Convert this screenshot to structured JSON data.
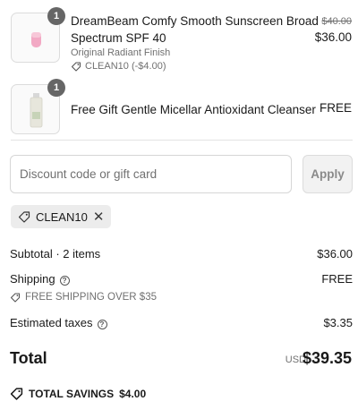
{
  "items": [
    {
      "quantity": "1",
      "title_line1": "DreamBeam Comfy Smooth Sunscreen Broad",
      "title_line2": "Spectrum SPF 40",
      "variant": "Original Radiant Finish",
      "discount_note": "CLEAN10 (-$4.00)",
      "price_original": "$40.00",
      "price": "$36.00",
      "thumb_icon": "sunscreen-bottle-icon"
    },
    {
      "quantity": "1",
      "title_line1": "Free Gift Gentle Micellar Antioxidant Cleanser",
      "price": "FREE",
      "thumb_icon": "cleanser-bottle-icon"
    }
  ],
  "discount": {
    "placeholder": "Discount code or gift card",
    "value": "",
    "apply_label": "Apply",
    "applied_code": "CLEAN10"
  },
  "summary": {
    "subtotal_label": "Subtotal · 2 items",
    "subtotal_value": "$36.00",
    "shipping_label": "Shipping",
    "shipping_value": "FREE",
    "shipping_note": "FREE SHIPPING OVER $35",
    "taxes_label": "Estimated taxes",
    "taxes_value": "$3.35",
    "total_label": "Total",
    "total_currency": "USD",
    "total_value": "$39.35",
    "savings_label": "TOTAL SAVINGS",
    "savings_value": "$4.00"
  },
  "colors": {
    "badge": "#666666",
    "muted_text": "#707070",
    "chip_bg": "#ececec",
    "apply_bg": "#f2f2f2"
  }
}
